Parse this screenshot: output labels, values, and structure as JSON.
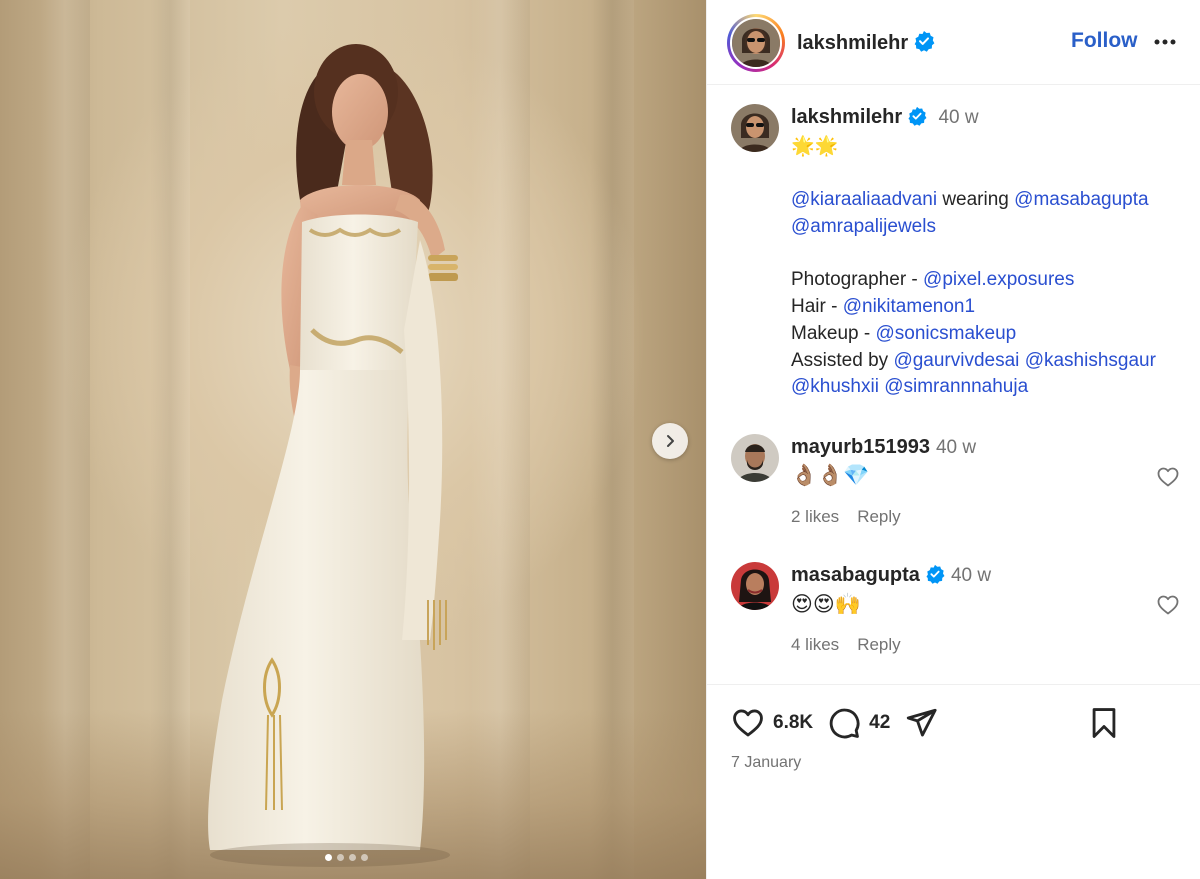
{
  "post": {
    "carousel_dots": 4,
    "active_dot": 0
  },
  "header": {
    "username": "lakshmilehr",
    "follow_label": "Follow"
  },
  "caption": {
    "username": "lakshmilehr",
    "time": "40 w",
    "emoji": "🌟🌟",
    "lines": [
      {
        "segments": [
          {
            "text": "@kiaraaliaadvani",
            "mention": true
          },
          {
            "text": " wearing ",
            "mention": false
          },
          {
            "text": "@masabagupta",
            "mention": true
          }
        ]
      },
      {
        "segments": [
          {
            "text": "@amrapalijewels",
            "mention": true
          }
        ]
      },
      {
        "segments": []
      },
      {
        "segments": [
          {
            "text": "Photographer - ",
            "mention": false
          },
          {
            "text": "@pixel.exposures",
            "mention": true
          }
        ]
      },
      {
        "segments": [
          {
            "text": "Hair - ",
            "mention": false
          },
          {
            "text": "@nikitamenon1",
            "mention": true
          }
        ]
      },
      {
        "segments": [
          {
            "text": "Makeup - ",
            "mention": false
          },
          {
            "text": "@sonicsmakeup",
            "mention": true
          }
        ]
      },
      {
        "segments": [
          {
            "text": "Assisted by ",
            "mention": false
          },
          {
            "text": "@gaurvivdesai",
            "mention": true
          },
          {
            "text": " ",
            "mention": false
          },
          {
            "text": "@kashishsgaur",
            "mention": true
          }
        ]
      },
      {
        "segments": [
          {
            "text": "@khushxii",
            "mention": true
          },
          {
            "text": " ",
            "mention": false
          },
          {
            "text": "@simrannnahuja",
            "mention": true
          }
        ]
      }
    ]
  },
  "comments": [
    {
      "username": "mayurb151993",
      "verified": false,
      "time": "40 w",
      "text": "👌🏽👌🏽💎",
      "likes": "2 likes",
      "reply": "Reply"
    },
    {
      "username": "masabagupta",
      "verified": true,
      "time": "40 w",
      "text": "😍😍🙌",
      "likes": "4 likes",
      "reply": "Reply"
    }
  ],
  "actions": {
    "like_count": "6.8K",
    "comment_count": "42",
    "date": "7 January"
  },
  "colors": {
    "mention": "#2a4fd0",
    "verified": "#0095f6",
    "follow": "#2a5fc8"
  }
}
